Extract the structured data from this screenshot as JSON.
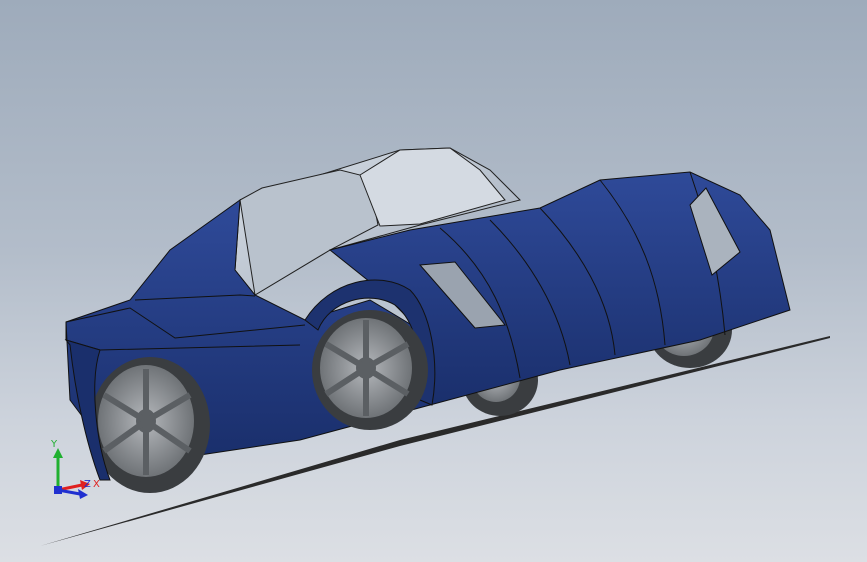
{
  "viewport": {
    "background_top": "#9eabbb",
    "background_bottom": "#dcdfe4"
  },
  "model": {
    "body_color": "#253f88",
    "body_dark": "#16295f",
    "glass_color": "#c8d0da",
    "wheel_color": "#8e9296",
    "tire_color": "#3a3d40"
  },
  "triad": {
    "x_label": "X",
    "y_label": "Y",
    "z_label": "Z",
    "x_color": "#e02020",
    "y_color": "#20b030",
    "z_color": "#2030d0"
  }
}
